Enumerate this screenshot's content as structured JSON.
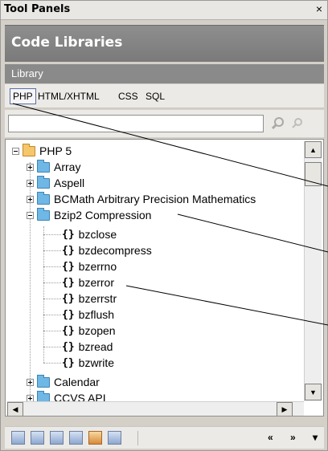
{
  "panel": {
    "title": "Tool Panels",
    "close_glyph": "×"
  },
  "header": {
    "title": "Code Libraries"
  },
  "library_bar": {
    "label": "Library"
  },
  "tabs": [
    "PHP",
    "HTML/XHTML",
    "CSS",
    "SQL"
  ],
  "search": {
    "value": "",
    "buttons": [
      "search-icon",
      "find-next-icon"
    ]
  },
  "tree": {
    "root": "PHP 5",
    "items": [
      "Array",
      "Aspell",
      "BCMath Arbitrary Precision Mathematics",
      "Bzip2 Compression",
      "bzclose",
      "bzdecompress",
      "bzerrno",
      "bzerror",
      "bzerrstr",
      "bzflush",
      "bzopen",
      "bzread",
      "bzwrite",
      "Calendar",
      "CCVS API"
    ],
    "expanded": "Bzip2 Compression",
    "function_glyph": "{}"
  },
  "scroll": {
    "up": "▲",
    "down": "▼",
    "left": "◀",
    "right": "▶"
  },
  "toolbar": {
    "icons": [
      "insert-icon",
      "new-item-icon",
      "import-icon",
      "export-icon",
      "edit-icon",
      "delete-icon"
    ],
    "prev_label": "«",
    "next_label": "»",
    "menu_label": "▾"
  },
  "colors": {
    "header_bg": "#7e7e7e",
    "library_bar_bg": "#8a8a8a",
    "folder": "#6fb7e4",
    "root_folder": "#f5c66a",
    "tab_highlight": "#5a6ea8"
  }
}
